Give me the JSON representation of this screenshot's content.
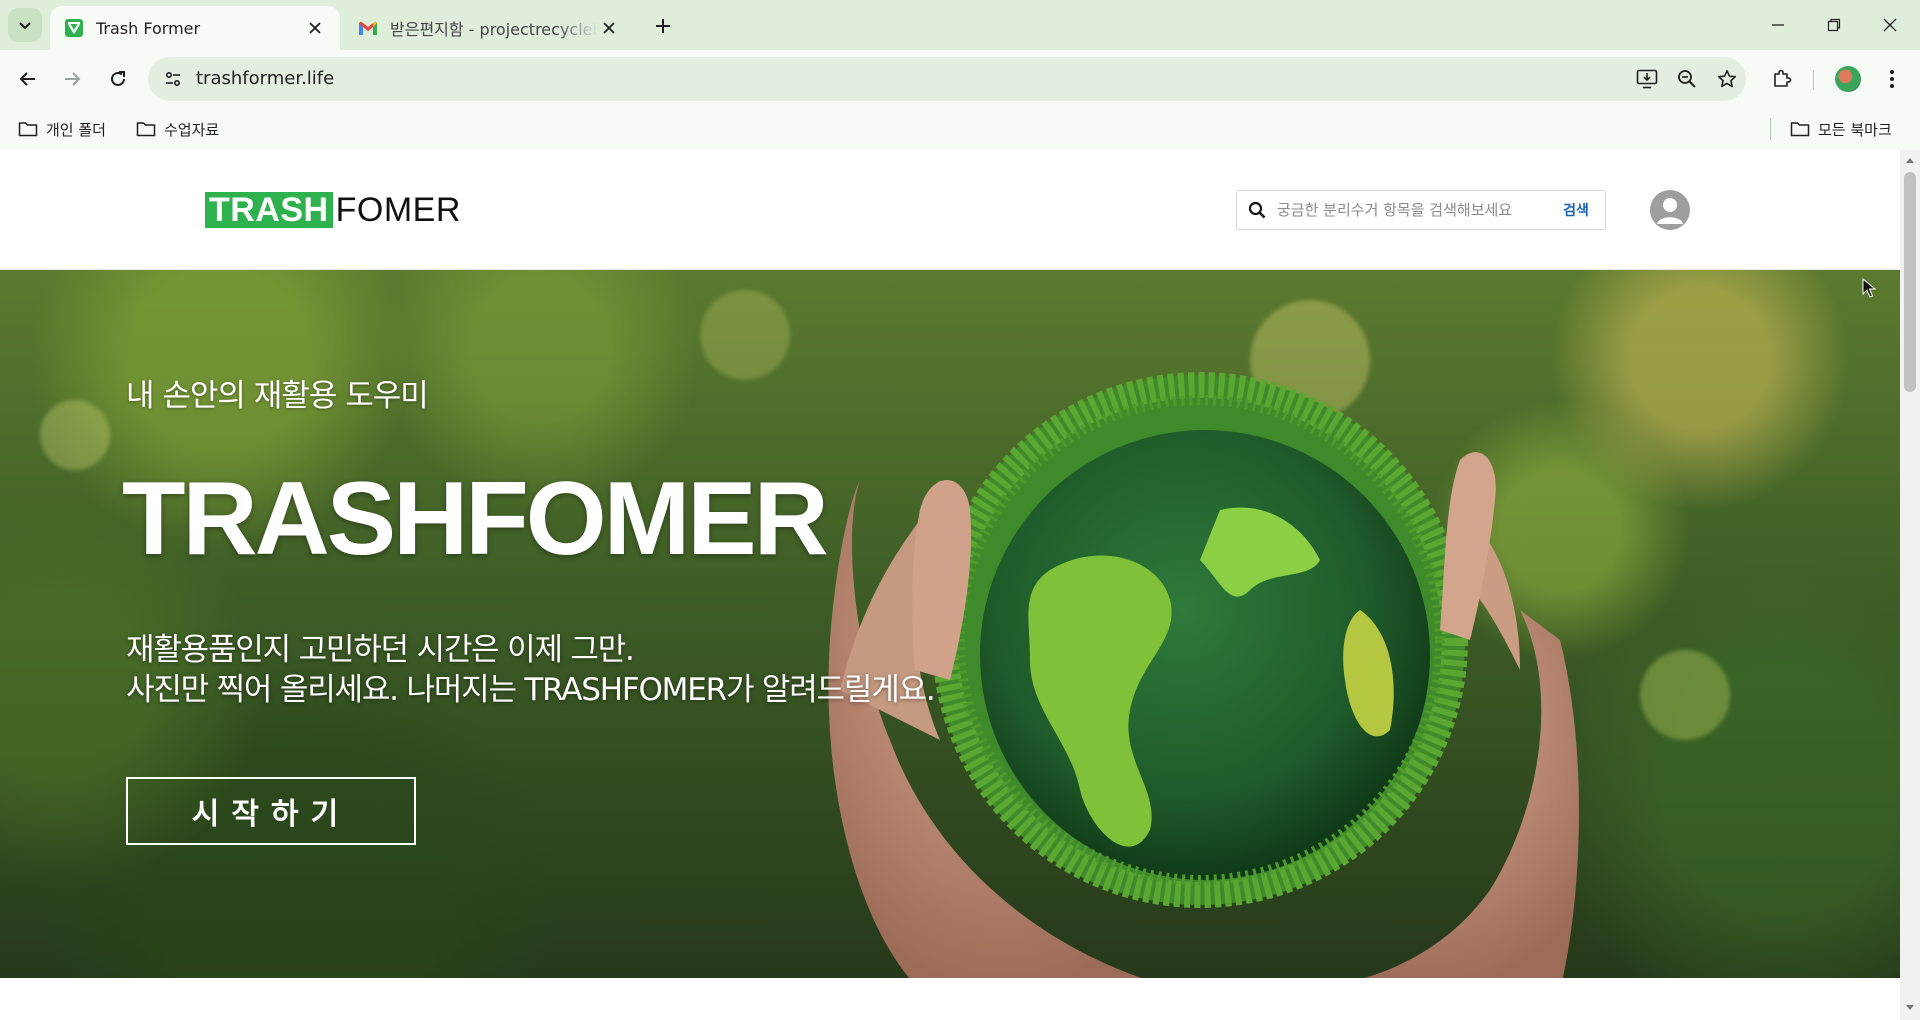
{
  "browser": {
    "tabs": [
      {
        "title": "Trash Former",
        "active": true
      },
      {
        "title": "받은편지함 - projectrecyclebs@",
        "active": false
      }
    ],
    "address": "trashformer.life",
    "bookmarks": {
      "left": [
        "개인 폴더",
        "수업자료"
      ],
      "right": "모든 북마크"
    },
    "colors": {
      "chrome_bg": "#dfeedb",
      "toolbar_bg": "#f7fbf5",
      "omnibox_bg": "#e3ede0"
    }
  },
  "site": {
    "logo": {
      "part1": "TRASH",
      "part2": "FOMER"
    },
    "search": {
      "placeholder": "궁금한 분리수거 항목을 검색해보세요",
      "button": "검색"
    },
    "brand_color": "#2eb24d"
  },
  "hero": {
    "subtitle": "내 손안의 재활용 도우미",
    "title": "TRASHFOMER",
    "desc_line1": "재활용품인지 고민하던 시간은 이제 그만.",
    "desc_line2": "사진만 찍어 올리세요. 나머지는 TRASHFOMER가 알려드릴게요.",
    "cta": "시작하기"
  }
}
